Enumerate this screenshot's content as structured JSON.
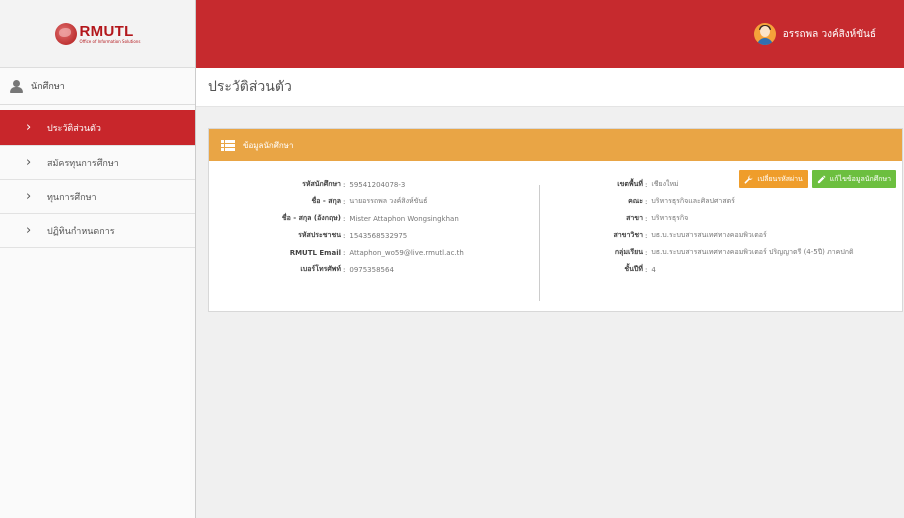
{
  "sidebar": {
    "logo": {
      "main": "RMUTL",
      "sub": "Office of Information Solutions"
    },
    "user_role": "นักศึกษา",
    "items": [
      {
        "label": "ประวัติส่วนตัว",
        "active": true
      },
      {
        "label": "สมัครทุนการศึกษา",
        "active": false
      },
      {
        "label": "ทุนการศึกษา",
        "active": false
      },
      {
        "label": "ปฏิทินกำหนดการ",
        "active": false
      }
    ]
  },
  "header": {
    "user_name": "อรรถพล วงค์สิงห์ขันธ์"
  },
  "page": {
    "title": "ประวัติส่วนตัว"
  },
  "panel": {
    "title": "ข้อมูลนักศึกษา",
    "buttons": {
      "change_password": "เปลี่ยนรหัสผ่าน",
      "edit_info": "แก้ไขข้อมูลนักศึกษา"
    },
    "left": [
      {
        "label": "รหัสนักศึกษา",
        "value": "59541204078-3"
      },
      {
        "label": "ชื่อ - สกุล",
        "value": "นายอรรถพล วงค์สิงห์ขันธ์"
      },
      {
        "label": "ชื่อ - สกุล (อังกฤษ)",
        "value": "Mister Attaphon Wongsingkhan"
      },
      {
        "label": "รหัสประชาชน",
        "value": "1543568532975"
      },
      {
        "label": "RMUTL Email",
        "value": "Attaphon_wo59@live.rmutl.ac.th"
      },
      {
        "label": "เบอร์โทรศัพท์",
        "value": "0975358564"
      }
    ],
    "right": [
      {
        "label": "เขตพื้นที่",
        "value": "เชียงใหม่"
      },
      {
        "label": "คณะ",
        "value": "บริหารธุรกิจและศิลปศาสตร์"
      },
      {
        "label": "สาขา",
        "value": "บริหารธุรกิจ"
      },
      {
        "label": "สาขาวิชา",
        "value": "บธ.บ.ระบบสารสนเทศทางคอมพิวเตอร์"
      },
      {
        "label": "กลุ่มเรียน",
        "value": "บธ.บ.ระบบสารสนเทศทางคอมพิวเตอร์ ปริญญาตรี (4-5ปี) ภาคปกติ"
      },
      {
        "label": "ชั้นปีที่",
        "value": "4"
      }
    ],
    "separator": ":"
  },
  "colors": {
    "brand_red": "#c62a2e",
    "panel_orange": "#e9a545",
    "button_orange": "#ef9d2b",
    "button_green": "#6cbf3f"
  },
  "icons": [
    "logo-icon",
    "user-icon",
    "chevron-right-icon",
    "list-icon",
    "wrench-icon",
    "pencil-icon",
    "avatar-icon"
  ]
}
